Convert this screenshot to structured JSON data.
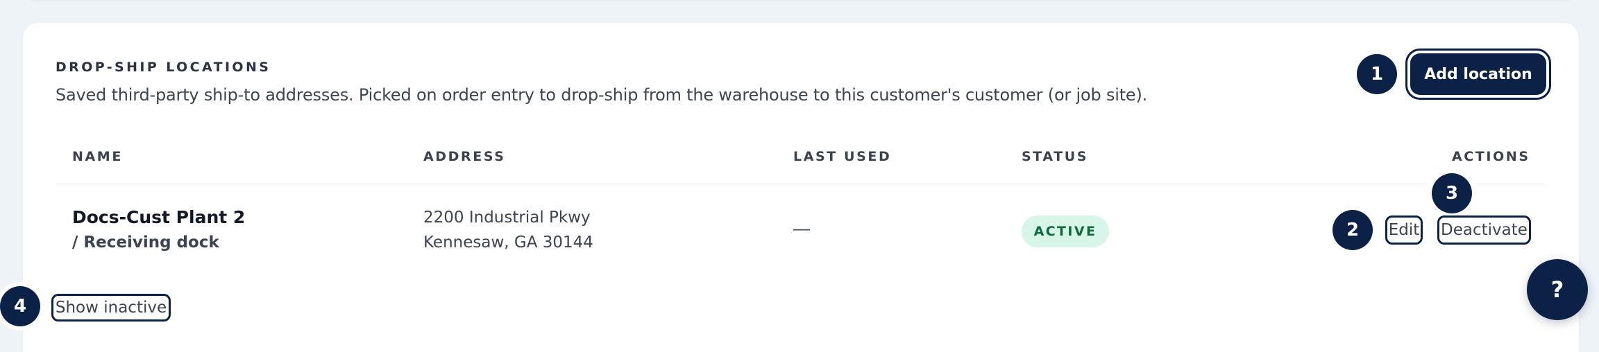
{
  "section": {
    "title": "DROP-SHIP LOCATIONS",
    "description": "Saved third-party ship-to addresses. Picked on order entry to drop-ship from the warehouse to this customer's customer (or job site)."
  },
  "toolbar": {
    "add_label": "Add location"
  },
  "annotations": [
    "1",
    "2",
    "3",
    "4"
  ],
  "table": {
    "columns": [
      "NAME",
      "ADDRESS",
      "LAST USED",
      "STATUS",
      "ACTIONS"
    ],
    "rows": [
      {
        "name_line1": "Docs-Cust Plant 2",
        "name_line2": "/ Receiving dock",
        "address_line1": "2200 Industrial Pkwy",
        "address_line2": "Kennesaw, GA 30144",
        "last_used": "—",
        "status": "ACTIVE",
        "edit_label": "Edit",
        "deactivate_label": "Deactivate"
      }
    ]
  },
  "footer": {
    "show_inactive_label": "Show inactive"
  },
  "help": {
    "label": "?"
  },
  "colors": {
    "accent": "#0b2246",
    "status_active_bg": "#d8f6e7",
    "status_active_text": "#0c6a3d"
  }
}
